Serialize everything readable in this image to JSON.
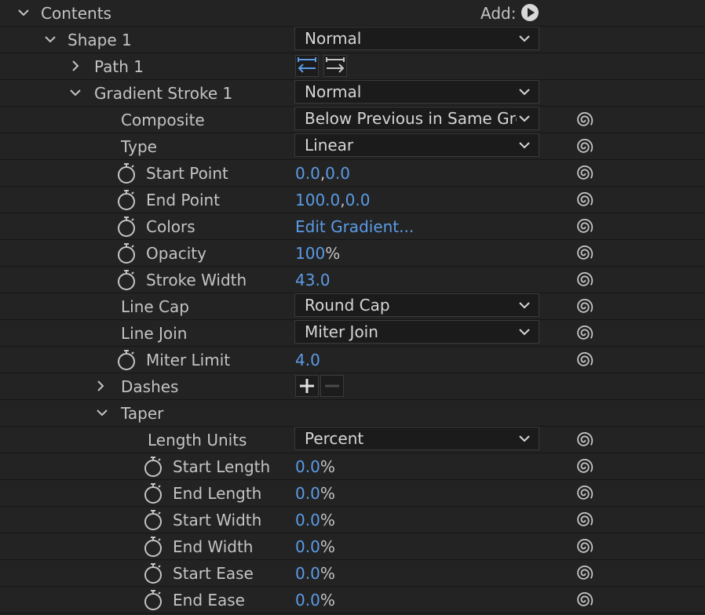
{
  "panel": {
    "contents_label": "Contents",
    "add_label": "Add:",
    "shape_label": "Shape 1",
    "shape_blend": "Normal",
    "path_label": "Path 1",
    "gradient_stroke_label": "Gradient Stroke 1",
    "gradient_stroke_blend": "Normal",
    "composite": {
      "label": "Composite",
      "value": "Below Previous in Same Group"
    },
    "type": {
      "label": "Type",
      "value": "Linear"
    },
    "start_point": {
      "label": "Start Point",
      "x": "0.0",
      "sep": ",",
      "y": "0.0"
    },
    "end_point": {
      "label": "End Point",
      "x": "100.0",
      "sep": ",",
      "y": "0.0"
    },
    "colors": {
      "label": "Colors",
      "value": "Edit Gradient..."
    },
    "opacity": {
      "label": "Opacity",
      "value": "100",
      "unit": "%"
    },
    "stroke_width": {
      "label": "Stroke Width",
      "value": "43.0"
    },
    "line_cap": {
      "label": "Line Cap",
      "value": "Round Cap"
    },
    "line_join": {
      "label": "Line Join",
      "value": "Miter Join"
    },
    "miter_limit": {
      "label": "Miter Limit",
      "value": "4.0"
    },
    "dashes_label": "Dashes",
    "taper_label": "Taper",
    "length_units": {
      "label": "Length Units",
      "value": "Percent"
    },
    "start_length": {
      "label": "Start Length",
      "value": "0.0",
      "unit": "%"
    },
    "end_length": {
      "label": "End Length",
      "value": "0.0",
      "unit": "%"
    },
    "start_width": {
      "label": "Start Width",
      "value": "0.0",
      "unit": "%"
    },
    "end_width": {
      "label": "End Width",
      "value": "0.0",
      "unit": "%"
    },
    "start_ease": {
      "label": "Start Ease",
      "value": "0.0",
      "unit": "%"
    },
    "end_ease": {
      "label": "End Ease",
      "value": "0.0",
      "unit": "%"
    }
  },
  "icons": {
    "twirl_open": "chevron-down-icon",
    "twirl_closed": "chevron-right-icon",
    "stopwatch": "stopwatch-icon",
    "expression": "spiral-icon",
    "add": "play-circle-icon",
    "path_direction": "path-direction-icon",
    "reverse_path": "reverse-path-icon",
    "plus": "plus-icon",
    "minus": "minus-icon"
  },
  "colors": {
    "background": "#232323",
    "text": "#c4c4c4",
    "value_blue": "#5b9be6",
    "dropdown_bg": "#1b1b1b"
  }
}
